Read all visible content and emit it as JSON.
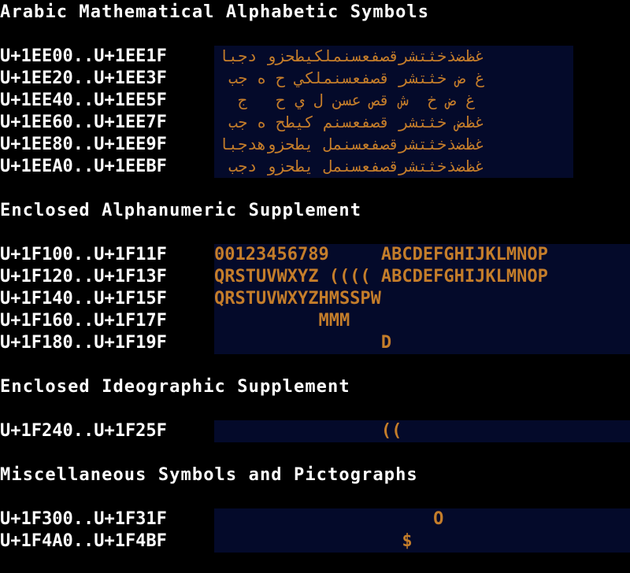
{
  "colors": {
    "background": "#000000",
    "text": "#ffffff",
    "cell_background": "#040a2a",
    "glyph": "#c47d2a"
  },
  "sections": [
    {
      "title": "Arabic Mathematical Alphabetic Symbols",
      "rows": [
        {
          "range": "U+1EE00..U+1EE1F",
          "glyphs": "ابجد وزحطيكلمنسعفصقرشتثخذضظغ"
        },
        {
          "range": "U+1EE20..U+1EE3F",
          "glyphs": " بج ه ح يكلمنسعفصق رشتثخ ض غ"
        },
        {
          "range": "U+1EE40..U+1EE5F",
          "glyphs": "  ج   ح ي ل نسع صق ش  خ ض غ"
        },
        {
          "range": "U+1EE60..U+1EE7F",
          "glyphs": " بج ه حطيك منسعفصق رشتثخ ضظغ"
        },
        {
          "range": "U+1EE80..U+1EE9F",
          "glyphs": "ابجدهوزحطي لمنسعفصقرشتثخذضظغ"
        },
        {
          "range": "U+1EEA0..U+1EEBF",
          "glyphs": " بجد وزحطي لمنسعفصقرشتثخذضظغ"
        }
      ]
    },
    {
      "title": "Enclosed Alphanumeric Supplement",
      "rows": [
        {
          "range": "U+1F100..U+1F11F",
          "glyphs": "00123456789     ABCDEFGHIJKLMNOP"
        },
        {
          "range": "U+1F120..U+1F13F",
          "glyphs": "QRSTUVWXYZ (((( ABCDEFGHIJKLMNOP"
        },
        {
          "range": "U+1F140..U+1F15F",
          "glyphs": "QRSTUVWXYZHMSSPW"
        },
        {
          "range": "U+1F160..U+1F17F",
          "glyphs": "          MMM"
        },
        {
          "range": "U+1F180..U+1F19F",
          "glyphs": "                D"
        }
      ]
    },
    {
      "title": "Enclosed Ideographic Supplement",
      "rows": [
        {
          "range": "U+1F240..U+1F25F",
          "glyphs": "                (("
        }
      ]
    },
    {
      "title": "Miscellaneous Symbols and Pictographs",
      "rows": [
        {
          "range": "U+1F300..U+1F31F",
          "glyphs": "                     O"
        },
        {
          "range": "U+1F4A0..U+1F4BF",
          "glyphs": "                  $"
        }
      ]
    }
  ]
}
